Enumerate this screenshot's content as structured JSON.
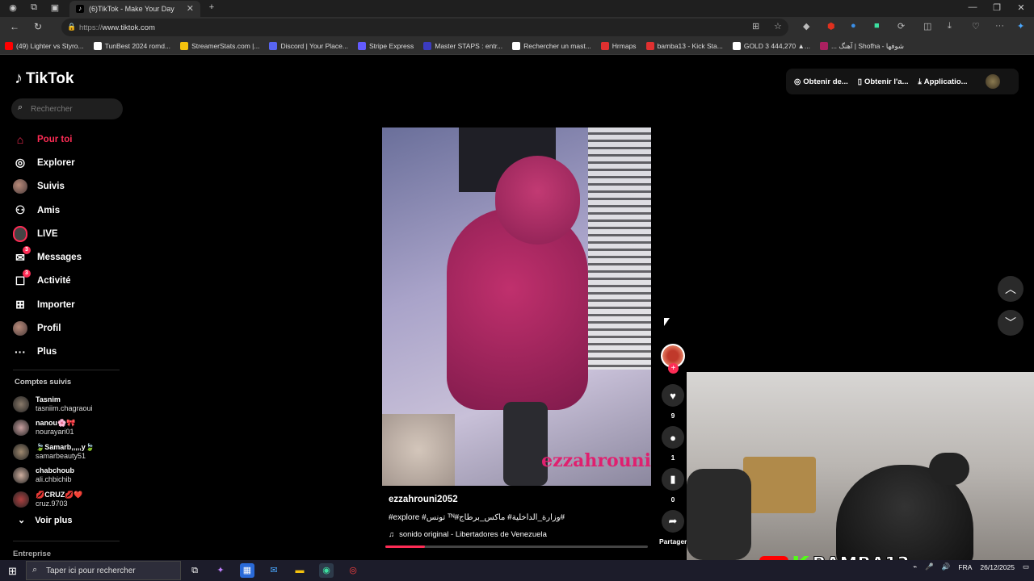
{
  "browser": {
    "tab_title": "(6)TikTok - Make Your Day",
    "url_prefix": "https://",
    "url_host": "www.tiktok.com",
    "bookmarks": [
      {
        "label": "(49) Lighter vs Styro...",
        "color": "#ff0000"
      },
      {
        "label": "TunBest 2024 romd...",
        "color": "#ffffff"
      },
      {
        "label": "StreamerStats.com |...",
        "color": "#f4c20d"
      },
      {
        "label": "Discord | Your Place...",
        "color": "#5865f2"
      },
      {
        "label": "Stripe Express",
        "color": "#635bff"
      },
      {
        "label": "Master STAPS : entr...",
        "color": "#3b3bc0"
      },
      {
        "label": "Rechercher un mast...",
        "color": "#ffffff"
      },
      {
        "label": "Hrmaps",
        "color": "#e03030"
      },
      {
        "label": "bamba13 - Kick Sta...",
        "color": "#e03030"
      },
      {
        "label": "GOLD 3 444,270 ▲...",
        "color": "#ffffff"
      },
      {
        "label": "... آهنگ | Shofha - شوفها",
        "color": "#aa2060"
      }
    ]
  },
  "tiktok": {
    "logo": "TikTok",
    "search_placeholder": "Rechercher",
    "nav": [
      {
        "label": "Pour toi",
        "icon": "home-icon",
        "glyph": "⌂",
        "active": true
      },
      {
        "label": "Explorer",
        "icon": "compass-icon",
        "glyph": "◎"
      },
      {
        "label": "Suivis",
        "icon": "following-avatar-icon",
        "glyph": ""
      },
      {
        "label": "Amis",
        "icon": "friends-icon",
        "glyph": "⚇"
      },
      {
        "label": "LIVE",
        "icon": "live-icon",
        "glyph": ""
      },
      {
        "label": "Messages",
        "icon": "messages-icon",
        "glyph": "✉",
        "badge": "3"
      },
      {
        "label": "Activité",
        "icon": "activity-icon",
        "glyph": "☐",
        "badge": "3"
      },
      {
        "label": "Importer",
        "icon": "upload-icon",
        "glyph": "⊞"
      },
      {
        "label": "Profil",
        "icon": "profile-icon",
        "glyph": ""
      },
      {
        "label": "Plus",
        "icon": "more-icon",
        "glyph": "···"
      }
    ],
    "following_title": "Comptes suivis",
    "following": [
      {
        "name": "Tasnim",
        "user": "tasniim.chagraoui",
        "color": "#8a7a6a"
      },
      {
        "name": "nanou🌸🎀",
        "user": "nourayari01",
        "color": "#c9a0a0"
      },
      {
        "name": "🍃Samarb,,,,,y🍃",
        "user": "samarbeauty51",
        "color": "#a08a70"
      },
      {
        "name": "chabchoub",
        "user": "ali.chbichib",
        "color": "#d0b0a0"
      },
      {
        "name": "💋CRUZ💋❤️",
        "user": "cruz.9703",
        "color": "#b04040"
      }
    ],
    "see_more": "Voir plus",
    "entreprise": "Entreprise",
    "topright": {
      "obtain_desktop": "Obtenir de...",
      "obtain_app": "Obtenir l'a...",
      "application": "Applicatio..."
    },
    "video": {
      "watermark": "ezzahrouni",
      "username": "ezzahrouni2052",
      "tags": "#explore #تونس ᵀᴺ#وزارة_الداخلية# ماكس_برطاج#",
      "music": "sonido original - Libertadores de Venezuela",
      "progress": 0.15
    },
    "actions": {
      "likes": "9",
      "comments": "1",
      "saves": "0",
      "share_label": "Partager"
    }
  },
  "stream_overlay": {
    "kick_letter": "K",
    "name": "BAMBA13"
  },
  "taskbar": {
    "search_placeholder": "Taper ici pour rechercher",
    "lang": "FRA",
    "date": "26/12/2025"
  }
}
